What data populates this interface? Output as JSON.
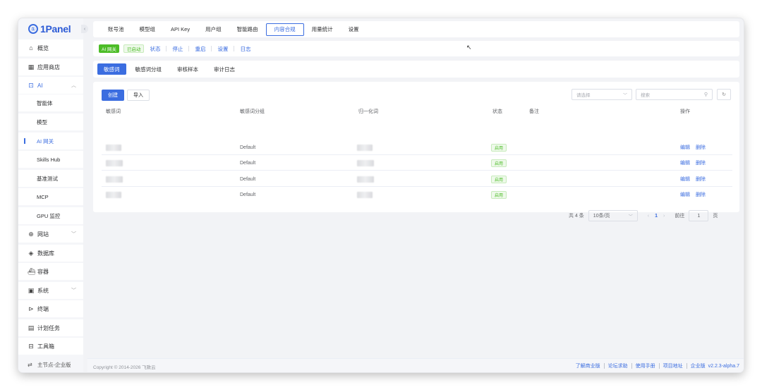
{
  "app": {
    "logo_text": "1Panel",
    "logo_mark": "①"
  },
  "sidebar": {
    "items": [
      {
        "label": "概览",
        "icon": "home-icon"
      },
      {
        "label": "应用商店",
        "icon": "grid-icon"
      },
      {
        "label": "AI",
        "icon": "robot-icon"
      },
      {
        "label": "网站",
        "icon": "globe-icon"
      },
      {
        "label": "数据库",
        "icon": "database-icon"
      },
      {
        "label": "容器",
        "icon": "container-icon"
      },
      {
        "label": "系统",
        "icon": "system-icon"
      },
      {
        "label": "终端",
        "icon": "terminal-icon"
      },
      {
        "label": "计划任务",
        "icon": "calendar-icon"
      },
      {
        "label": "工具箱",
        "icon": "toolbox-icon"
      }
    ],
    "ai_children": [
      "智能体",
      "模型",
      "AI 网关",
      "Skills Hub",
      "基准测试",
      "MCP",
      "GPU 监控"
    ],
    "bottom_label": "主节点-企业版"
  },
  "top_tabs": [
    "账号池",
    "模型组",
    "API Key",
    "用户组",
    "智能路由",
    "内容合规",
    "用量统计",
    "设置"
  ],
  "status_bar": {
    "name_tag": "AI 网关",
    "state_tag": "已启动",
    "actions": [
      "状态",
      "停止",
      "重启",
      "设置",
      "日志"
    ]
  },
  "sub_tabs": [
    "敏感词",
    "敏感词分组",
    "审核样本",
    "审计日志"
  ],
  "toolbar": {
    "create_label": "创建",
    "import_label": "导入",
    "select_placeholder": "请选择",
    "search_placeholder": "搜索"
  },
  "table": {
    "headers": [
      "敏感词",
      "敏感词分组",
      "归一化词",
      "状态",
      "备注",
      "操作"
    ],
    "rows": [
      {
        "group": "Default",
        "status": "启用",
        "edit": "编辑",
        "delete": "删除"
      },
      {
        "group": "Default",
        "status": "启用",
        "edit": "编辑",
        "delete": "删除"
      },
      {
        "group": "Default",
        "status": "启用",
        "edit": "编辑",
        "delete": "删除"
      },
      {
        "group": "Default",
        "status": "启用",
        "edit": "编辑",
        "delete": "删除"
      }
    ]
  },
  "pagination": {
    "total": "共 4 条",
    "page_size": "10条/页",
    "current_page": "1",
    "goto_label": "前往",
    "goto_value": "1",
    "page_suffix": "页"
  },
  "footer": {
    "copyright": "Copyright © 2014-2026 飞致云",
    "links": [
      "了解商业版",
      "论坛求助",
      "使用手册",
      "项目地址",
      "企业版"
    ],
    "version": "v2.2.3-alpha.7"
  },
  "colors": {
    "accent": "#3b6de0",
    "success": "#4cbc27"
  }
}
